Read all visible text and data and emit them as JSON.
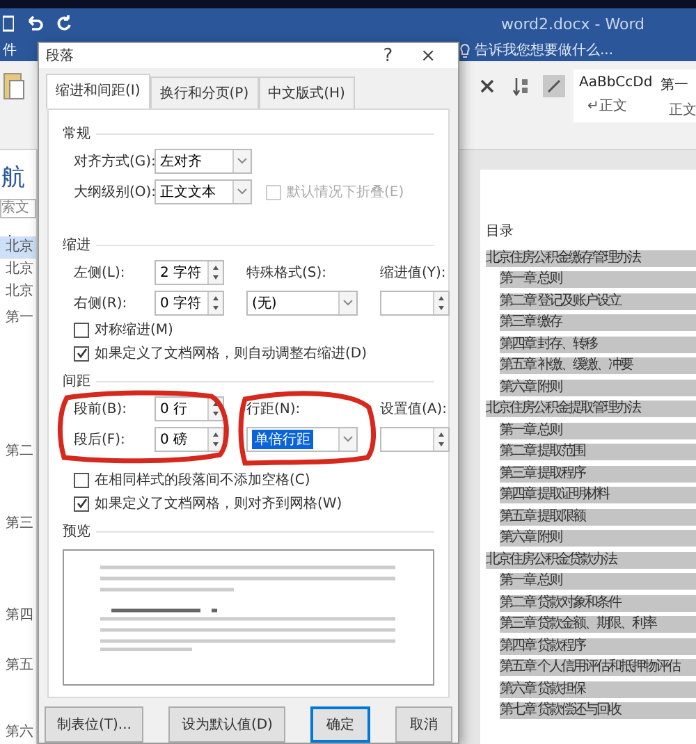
{
  "title_bar": {
    "title": "word2.docx - Word"
  },
  "ribbon": {
    "tell_me": "告诉我您想要做什么...",
    "tab": "件",
    "styles": [
      {
        "sample": "AaBbCcDd",
        "name": "↵正文"
      },
      {
        "sample": "第一",
        "name": "正文"
      }
    ]
  },
  "navigation": {
    "title": "航",
    "search_placeholder": "索文",
    "items": [
      {
        "label": "北京",
        "selected": true
      },
      {
        "label": "北京",
        "selected": false
      },
      {
        "label": "北京",
        "selected": false
      },
      {
        "label": "第一",
        "selected": false
      },
      {
        "label": "第二",
        "selected": false
      },
      {
        "label": "第三",
        "selected": false
      },
      {
        "label": "第四",
        "selected": false
      },
      {
        "label": "第五",
        "selected": false
      },
      {
        "label": "第六",
        "selected": false
      }
    ]
  },
  "document": {
    "heading": "目录",
    "toc": [
      {
        "text": "北京住房公积金缴存管理办法",
        "children": [
          {
            "text": "第一章 总则"
          },
          {
            "text": "第二章 登记及账户设立"
          },
          {
            "text": "第三章 缴存"
          },
          {
            "text": "第四章 封存、转移"
          },
          {
            "text": "第五章 补缴、缓缴、冲要"
          },
          {
            "text": "第六章 附则"
          }
        ]
      },
      {
        "text": "北京住房公积金提取管理办法",
        "children": [
          {
            "text": "第一章 总则"
          },
          {
            "text": "第二章 提取范围"
          },
          {
            "text": "第三章 提取程序"
          },
          {
            "text": "第四章 提取证明材料"
          },
          {
            "text": "第五章 提取限额"
          },
          {
            "text": "第六章 附则"
          }
        ]
      },
      {
        "text": "北京住房公积金贷款办法",
        "children": [
          {
            "text": "第一章 总则"
          },
          {
            "text": "第二章 贷款对象和条件"
          },
          {
            "text": "第三章 贷款金额、期限、利率"
          },
          {
            "text": "第四章 贷款程序"
          },
          {
            "text": "第五章 个人信用评估和抵押物评估"
          },
          {
            "text": "第六章 贷款担保"
          },
          {
            "text": "第七章 贷款偿还与回收"
          }
        ]
      }
    ]
  },
  "dialog": {
    "title": "段落",
    "help": "?",
    "close": "×",
    "tabs": [
      {
        "label": "缩进和间距(I)",
        "selected": true
      },
      {
        "label": "换行和分页(P)",
        "selected": false
      },
      {
        "label": "中文版式(H)",
        "selected": false
      }
    ],
    "general": {
      "heading": "常规",
      "alignment": {
        "label": "对齐方式(G):",
        "value": "左对齐"
      },
      "outline": {
        "label": "大纲级别(O):",
        "value": "正文文本"
      },
      "collapse": {
        "label": "默认情况下折叠(E)",
        "disabled": true
      }
    },
    "indent": {
      "heading": "缩进",
      "left": {
        "label": "左侧(L):",
        "value": "2 字符"
      },
      "right": {
        "label": "右侧(R):",
        "value": "0 字符"
      },
      "special": {
        "label": "特殊格式(S):",
        "value": "(无)"
      },
      "by": {
        "label": "缩进值(Y):"
      },
      "checks": [
        {
          "label": "对称缩进(M)",
          "checked": false
        },
        {
          "label": "如果定义了文档网格，则自动调整右缩进(D)",
          "checked": true
        }
      ]
    },
    "spacing": {
      "heading": "间距",
      "before": {
        "label": "段前(B):",
        "value": "0 行"
      },
      "after": {
        "label": "段后(F):",
        "value": "0 磅"
      },
      "line": {
        "label": "行距(N):",
        "value": "单倍行距",
        "selected": true
      },
      "at": {
        "label": "设置值(A):"
      },
      "checks": [
        {
          "label": "在相同样式的段落间不添加空格(C)",
          "checked": false
        },
        {
          "label": "如果定义了文档网格，则对齐到网格(W)",
          "checked": true
        }
      ]
    },
    "preview": {
      "heading": "预览"
    },
    "buttons": [
      {
        "label": "制表位(T)...",
        "default": false
      },
      {
        "label": "设为默认值(D)",
        "default": false
      },
      {
        "label": "确定",
        "default": true
      },
      {
        "label": "取消",
        "default": false
      }
    ]
  }
}
